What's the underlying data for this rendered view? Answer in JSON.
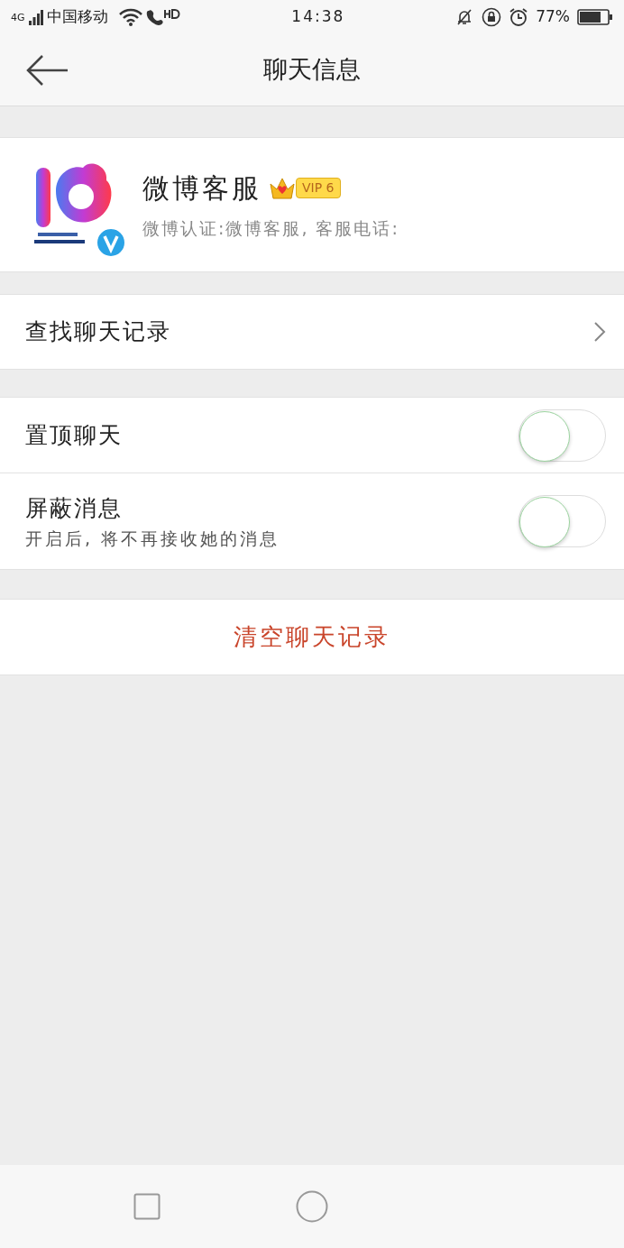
{
  "status_bar": {
    "network": "4G",
    "carrier": "中国移动",
    "time": "14:38",
    "battery_text": "77%"
  },
  "header": {
    "title": "聊天信息"
  },
  "profile": {
    "name": "微博客服",
    "vip": "VIP 6",
    "description": "微博认证:微博客服, 客服电话:"
  },
  "search_row": {
    "label": "查找聊天记录"
  },
  "settings": [
    {
      "label": "置顶聊天",
      "on": false
    },
    {
      "label": "屏蔽消息",
      "hint": "开启后, 将不再接收她的消息",
      "on": false
    }
  ],
  "clear_button": {
    "label": "清空聊天记录"
  }
}
